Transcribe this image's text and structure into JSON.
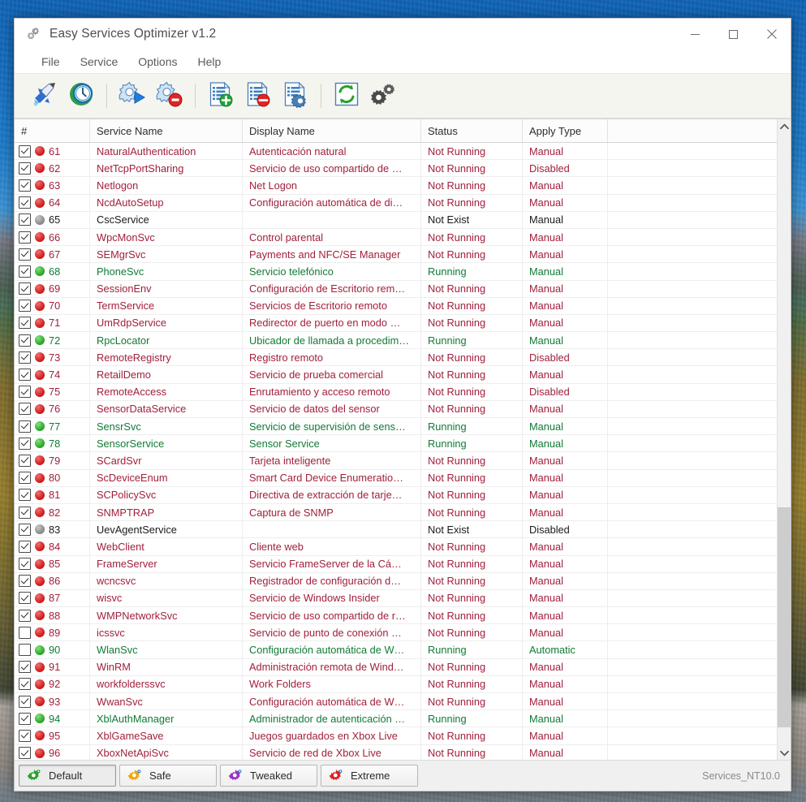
{
  "window": {
    "title": "Easy Services Optimizer v1.2",
    "app_icon": "gears-icon",
    "controls": {
      "minimize": "minimize-icon",
      "maximize": "maximize-icon",
      "close": "close-icon"
    }
  },
  "menubar": {
    "items": [
      {
        "label": "File"
      },
      {
        "label": "Service"
      },
      {
        "label": "Options"
      },
      {
        "label": "Help"
      }
    ]
  },
  "toolbar": {
    "buttons": [
      {
        "name": "optimize-rocket-button",
        "icon": "rocket-icon",
        "tooltip": "Optimize"
      },
      {
        "name": "restore-point-button",
        "icon": "clock-restore-icon",
        "tooltip": "Restore Point"
      },
      {
        "name": "start-service-button",
        "icon": "gear-play-icon",
        "tooltip": "Start Service"
      },
      {
        "name": "stop-service-button",
        "icon": "gear-stop-icon",
        "tooltip": "Stop Service"
      },
      {
        "name": "add-service-button",
        "icon": "document-add-icon",
        "tooltip": "Add Service"
      },
      {
        "name": "remove-service-button",
        "icon": "document-remove-icon",
        "tooltip": "Remove Service"
      },
      {
        "name": "edit-service-button",
        "icon": "document-settings-icon",
        "tooltip": "Edit Service"
      },
      {
        "name": "refresh-button",
        "icon": "refresh-icon",
        "tooltip": "Refresh"
      },
      {
        "name": "settings-button",
        "icon": "gears-settings-icon",
        "tooltip": "Settings"
      }
    ]
  },
  "table": {
    "columns": [
      {
        "key": "num",
        "label": "#"
      },
      {
        "key": "service",
        "label": "Service Name"
      },
      {
        "key": "display",
        "label": "Display Name"
      },
      {
        "key": "status",
        "label": "Status"
      },
      {
        "key": "apply",
        "label": "Apply Type"
      },
      {
        "key": "pad",
        "label": ""
      }
    ],
    "rows": [
      {
        "checked": true,
        "dot": "red",
        "num": "61",
        "service": "NaturalAuthentication",
        "display": "Autenticación natural",
        "status": "Not Running",
        "apply": "Manual",
        "tone": "red"
      },
      {
        "checked": true,
        "dot": "red",
        "num": "62",
        "service": "NetTcpPortSharing",
        "display": "Servicio de uso compartido de …",
        "status": "Not Running",
        "apply": "Disabled",
        "tone": "red"
      },
      {
        "checked": true,
        "dot": "red",
        "num": "63",
        "service": "Netlogon",
        "display": "Net Logon",
        "status": "Not Running",
        "apply": "Manual",
        "tone": "red"
      },
      {
        "checked": true,
        "dot": "red",
        "num": "64",
        "service": "NcdAutoSetup",
        "display": "Configuración automática de di…",
        "status": "Not Running",
        "apply": "Manual",
        "tone": "red"
      },
      {
        "checked": true,
        "dot": "gray",
        "num": "65",
        "service": "CscService",
        "display": "",
        "status": "Not Exist",
        "apply": "Manual",
        "tone": "black"
      },
      {
        "checked": true,
        "dot": "red",
        "num": "66",
        "service": "WpcMonSvc",
        "display": "Control parental",
        "status": "Not Running",
        "apply": "Manual",
        "tone": "red"
      },
      {
        "checked": true,
        "dot": "red",
        "num": "67",
        "service": "SEMgrSvc",
        "display": "Payments and NFC/SE Manager",
        "status": "Not Running",
        "apply": "Manual",
        "tone": "red"
      },
      {
        "checked": true,
        "dot": "green",
        "num": "68",
        "service": "PhoneSvc",
        "display": "Servicio telefónico",
        "status": "Running",
        "apply": "Manual",
        "tone": "green"
      },
      {
        "checked": true,
        "dot": "red",
        "num": "69",
        "service": "SessionEnv",
        "display": "Configuración de Escritorio rem…",
        "status": "Not Running",
        "apply": "Manual",
        "tone": "red"
      },
      {
        "checked": true,
        "dot": "red",
        "num": "70",
        "service": "TermService",
        "display": "Servicios de Escritorio remoto",
        "status": "Not Running",
        "apply": "Manual",
        "tone": "red"
      },
      {
        "checked": true,
        "dot": "red",
        "num": "71",
        "service": "UmRdpService",
        "display": "Redirector de puerto en modo …",
        "status": "Not Running",
        "apply": "Manual",
        "tone": "red"
      },
      {
        "checked": true,
        "dot": "green",
        "num": "72",
        "service": "RpcLocator",
        "display": "Ubicador de llamada a procedim…",
        "status": "Running",
        "apply": "Manual",
        "tone": "green"
      },
      {
        "checked": true,
        "dot": "red",
        "num": "73",
        "service": "RemoteRegistry",
        "display": "Registro remoto",
        "status": "Not Running",
        "apply": "Disabled",
        "tone": "red"
      },
      {
        "checked": true,
        "dot": "red",
        "num": "74",
        "service": "RetailDemo",
        "display": "Servicio de prueba comercial",
        "status": "Not Running",
        "apply": "Manual",
        "tone": "red"
      },
      {
        "checked": true,
        "dot": "red",
        "num": "75",
        "service": "RemoteAccess",
        "display": "Enrutamiento y acceso remoto",
        "status": "Not Running",
        "apply": "Disabled",
        "tone": "red"
      },
      {
        "checked": true,
        "dot": "red",
        "num": "76",
        "service": "SensorDataService",
        "display": "Servicio de datos del sensor",
        "status": "Not Running",
        "apply": "Manual",
        "tone": "red"
      },
      {
        "checked": true,
        "dot": "green",
        "num": "77",
        "service": "SensrSvc",
        "display": "Servicio de supervisión de sens…",
        "status": "Running",
        "apply": "Manual",
        "tone": "green"
      },
      {
        "checked": true,
        "dot": "green",
        "num": "78",
        "service": "SensorService",
        "display": "Sensor Service",
        "status": "Running",
        "apply": "Manual",
        "tone": "green"
      },
      {
        "checked": true,
        "dot": "red",
        "num": "79",
        "service": "SCardSvr",
        "display": "Tarjeta inteligente",
        "status": "Not Running",
        "apply": "Manual",
        "tone": "red"
      },
      {
        "checked": true,
        "dot": "red",
        "num": "80",
        "service": "ScDeviceEnum",
        "display": "Smart Card Device Enumeratio…",
        "status": "Not Running",
        "apply": "Manual",
        "tone": "red"
      },
      {
        "checked": true,
        "dot": "red",
        "num": "81",
        "service": "SCPolicySvc",
        "display": "Directiva de extracción de tarje…",
        "status": "Not Running",
        "apply": "Manual",
        "tone": "red"
      },
      {
        "checked": true,
        "dot": "red",
        "num": "82",
        "service": "SNMPTRAP",
        "display": "Captura de SNMP",
        "status": "Not Running",
        "apply": "Manual",
        "tone": "red"
      },
      {
        "checked": true,
        "dot": "gray",
        "num": "83",
        "service": "UevAgentService",
        "display": "",
        "status": "Not Exist",
        "apply": "Disabled",
        "tone": "black"
      },
      {
        "checked": true,
        "dot": "red",
        "num": "84",
        "service": "WebClient",
        "display": "Cliente web",
        "status": "Not Running",
        "apply": "Manual",
        "tone": "red"
      },
      {
        "checked": true,
        "dot": "red",
        "num": "85",
        "service": "FrameServer",
        "display": "Servicio FrameServer de la Cá…",
        "status": "Not Running",
        "apply": "Manual",
        "tone": "red"
      },
      {
        "checked": true,
        "dot": "red",
        "num": "86",
        "service": "wcncsvc",
        "display": "Registrador de configuración d…",
        "status": "Not Running",
        "apply": "Manual",
        "tone": "red"
      },
      {
        "checked": true,
        "dot": "red",
        "num": "87",
        "service": "wisvc",
        "display": "Servicio de Windows Insider",
        "status": "Not Running",
        "apply": "Manual",
        "tone": "red"
      },
      {
        "checked": true,
        "dot": "red",
        "num": "88",
        "service": "WMPNetworkSvc",
        "display": "Servicio de uso compartido de r…",
        "status": "Not Running",
        "apply": "Manual",
        "tone": "red"
      },
      {
        "checked": false,
        "dot": "red",
        "num": "89",
        "service": "icssvc",
        "display": "Servicio de punto de conexión …",
        "status": "Not Running",
        "apply": "Manual",
        "tone": "red"
      },
      {
        "checked": false,
        "dot": "green",
        "num": "90",
        "service": "WlanSvc",
        "display": "Configuración automática de W…",
        "status": "Running",
        "apply": "Automatic",
        "tone": "green"
      },
      {
        "checked": true,
        "dot": "red",
        "num": "91",
        "service": "WinRM",
        "display": "Administración remota de Wind…",
        "status": "Not Running",
        "apply": "Manual",
        "tone": "red"
      },
      {
        "checked": true,
        "dot": "red",
        "num": "92",
        "service": "workfolderssvc",
        "display": "Work Folders",
        "status": "Not Running",
        "apply": "Manual",
        "tone": "red"
      },
      {
        "checked": true,
        "dot": "red",
        "num": "93",
        "service": "WwanSvc",
        "display": "Configuración automática de W…",
        "status": "Not Running",
        "apply": "Manual",
        "tone": "red"
      },
      {
        "checked": true,
        "dot": "green",
        "num": "94",
        "service": "XblAuthManager",
        "display": "Administrador de autenticación …",
        "status": "Running",
        "apply": "Manual",
        "tone": "green"
      },
      {
        "checked": true,
        "dot": "red",
        "num": "95",
        "service": "XblGameSave",
        "display": "Juegos guardados en Xbox Live",
        "status": "Not Running",
        "apply": "Manual",
        "tone": "red"
      },
      {
        "checked": true,
        "dot": "red",
        "num": "96",
        "service": "XboxNetApiSvc",
        "display": "Servicio de red de Xbox Live",
        "status": "Not Running",
        "apply": "Manual",
        "tone": "red"
      }
    ]
  },
  "statusbar": {
    "presets": [
      {
        "label": "Default",
        "icon": "gear-icon",
        "color": "#2aa02a",
        "active": true
      },
      {
        "label": "Safe",
        "icon": "gear-icon",
        "color": "#f0a500",
        "active": false
      },
      {
        "label": "Tweaked",
        "icon": "gear-icon",
        "color": "#9b30c8",
        "active": false
      },
      {
        "label": "Extreme",
        "icon": "gear-icon",
        "color": "#e02020",
        "active": false
      }
    ],
    "info": "Services_NT10.0"
  },
  "colors": {
    "status_red": "#a1203c",
    "status_green": "#117a35",
    "status_black": "#1a1a1a",
    "toolbar_bg": "#f5f5f0",
    "accent_blue": "#0a66c2"
  }
}
